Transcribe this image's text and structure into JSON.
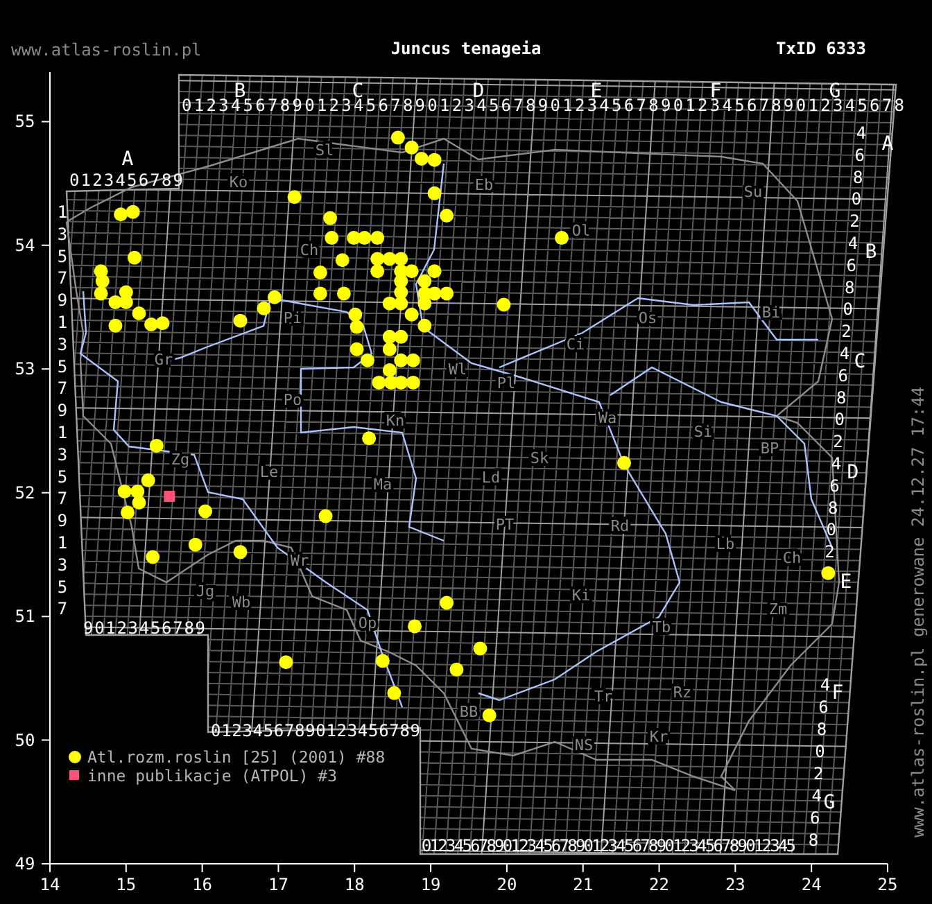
{
  "header": {
    "site": "www.atlas-roslin.pl",
    "title": "Juncus tenageia",
    "taxon_id": "TxID 6333"
  },
  "map": {
    "grid_labels": {
      "column_letters": [
        "B",
        "C",
        "D",
        "E",
        "F",
        "G"
      ],
      "top_digits": "01234567890123456789012345678901234567890123456789012345678",
      "a_letter": "A",
      "a_digits": "0123456789",
      "left_digits": [
        "1",
        "3",
        "5",
        "7",
        "9",
        "1",
        "3",
        "5",
        "7",
        "9",
        "1",
        "3",
        "5",
        "7",
        "9",
        "1",
        "3",
        "5",
        "7"
      ],
      "bottom_left_digits": "90123456789",
      "bottom_mid_digits": "01234567890123456789",
      "bottom_digits": "0123456789012345678901234567890123456789012345",
      "right_digits_upper": [
        "4",
        "6",
        "8",
        "0",
        "2",
        "4",
        "6",
        "8",
        "0",
        "2",
        "4",
        "6",
        "8",
        "0",
        "2",
        "4",
        "6",
        "8",
        "0",
        "2"
      ],
      "right_digits_lower": [
        "4",
        "6",
        "8",
        "0",
        "2",
        "4",
        "6",
        "8"
      ],
      "row_letters": [
        "A",
        "B",
        "C",
        "D",
        "E",
        "F",
        "G"
      ]
    },
    "region_labels": [
      "Sl",
      "Ko",
      "Eb",
      "Su",
      "Ol",
      "Ch",
      "Pi",
      "Os",
      "Bi",
      "Ci",
      "Pl",
      "Wa",
      "Si",
      "BP",
      "Sk",
      "Ld",
      "PT",
      "Rd",
      "Lb",
      "Ch",
      "Ki",
      "Zm",
      "Tb",
      "Tr",
      "Rz",
      "NS",
      "Kr",
      "BB",
      "Le",
      "Zg",
      "Ma",
      "Po",
      "Wr",
      "Wb",
      "Jg",
      "Op",
      "Wl",
      "Gr",
      "Kn"
    ],
    "chart_data": {
      "type": "scatter",
      "legend": true,
      "xlim": [
        14,
        25
      ],
      "ylim": [
        49,
        55.4
      ],
      "xticks": [
        14,
        15,
        16,
        17,
        18,
        19,
        20,
        21,
        22,
        23,
        24,
        25
      ],
      "yticks": [
        49,
        50,
        51,
        52,
        53,
        54,
        55
      ],
      "series": [
        {
          "name": "Atl.rozm.roslin [25] (2001) #88",
          "color": "#ffff00",
          "x": [
            18.57,
            18.75,
            18.88,
            19.05,
            17.21,
            19.05,
            19.21,
            14.93,
            15.09,
            17.68,
            15.11,
            17.7,
            17.99,
            18.13,
            18.3,
            17.84,
            18.3,
            18.46,
            18.61,
            18.3,
            18.61,
            18.75,
            19.05,
            14.67,
            14.69,
            14.67,
            15.0,
            14.86,
            15.0,
            17.55,
            18.61,
            18.92,
            17.55,
            17.86,
            16.95,
            16.81,
            18.61,
            18.92,
            19.05,
            19.21,
            18.46,
            18.61,
            18.92,
            15.17,
            18.01,
            18.75,
            18.92,
            14.86,
            15.33,
            15.48,
            16.5,
            18.03,
            18.46,
            18.61,
            18.03,
            18.46,
            18.17,
            18.61,
            18.77,
            18.46,
            18.32,
            18.48,
            18.61,
            18.77,
            18.19,
            15.4,
            15.29,
            14.98,
            15.15,
            15.17,
            15.02,
            16.04,
            17.62,
            15.91,
            15.35,
            16.5,
            19.21,
            18.79,
            20.72,
            19.96,
            21.54,
            24.22,
            17.1,
            18.37,
            18.52,
            19.34,
            19.65,
            19.77
          ],
          "values": [
            54.87,
            54.79,
            54.7,
            54.69,
            54.39,
            54.42,
            54.24,
            54.25,
            54.27,
            54.22,
            53.9,
            54.06,
            54.06,
            54.06,
            54.06,
            53.88,
            53.89,
            53.89,
            53.89,
            53.79,
            53.79,
            53.79,
            53.79,
            53.79,
            53.71,
            53.61,
            53.62,
            53.54,
            53.54,
            53.78,
            53.71,
            53.71,
            53.61,
            53.61,
            53.58,
            53.49,
            53.62,
            53.61,
            53.61,
            53.61,
            53.53,
            53.53,
            53.53,
            53.45,
            53.44,
            53.44,
            53.35,
            53.35,
            53.36,
            53.37,
            53.39,
            53.34,
            53.26,
            53.26,
            53.16,
            53.16,
            53.07,
            53.07,
            53.07,
            52.99,
            52.89,
            52.89,
            52.89,
            52.89,
            52.44,
            52.38,
            52.1,
            52.01,
            52.01,
            51.92,
            51.84,
            51.85,
            51.81,
            51.58,
            51.48,
            51.52,
            51.11,
            50.92,
            54.06,
            53.52,
            52.24,
            51.35,
            50.63,
            50.64,
            50.38,
            50.57,
            50.74,
            50.2
          ]
        },
        {
          "name": "inne publikacje (ATPOL) #3",
          "color": "#ff5077",
          "x": [
            15.57
          ],
          "values": [
            51.97
          ]
        }
      ]
    }
  },
  "footer_vertical": "www.atlas-roslin.pl generowane 24.12.27 17:44"
}
